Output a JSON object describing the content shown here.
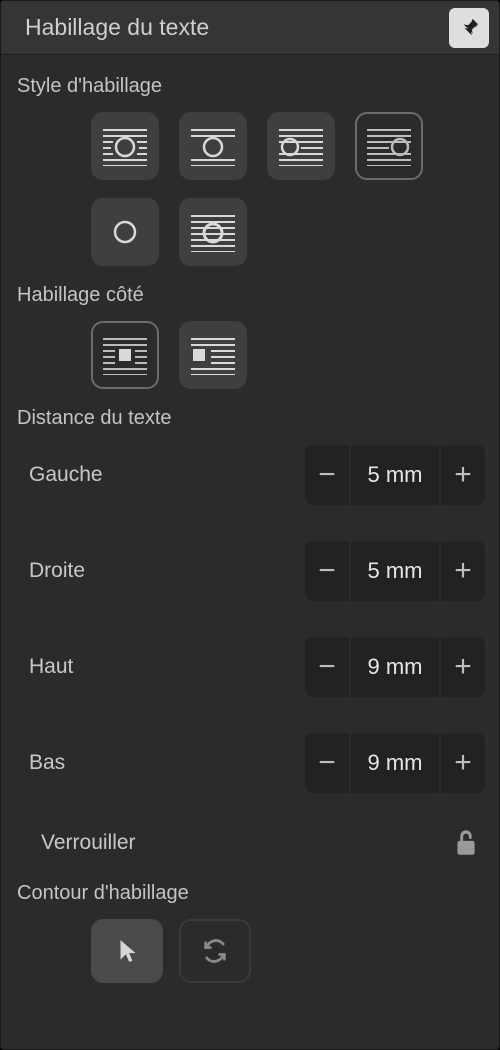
{
  "title": "Habillage du texte",
  "sections": {
    "style": "Style d'habillage",
    "side": "Habillage côté",
    "distance": "Distance du texte",
    "lock": "Verrouiller",
    "outline": "Contour d'habillage"
  },
  "style_tiles": [
    {
      "name": "wrap-around-circle",
      "selected": false
    },
    {
      "name": "wrap-jump-circle",
      "selected": false
    },
    {
      "name": "wrap-left-circle",
      "selected": false
    },
    {
      "name": "wrap-right-circle",
      "selected": true
    },
    {
      "name": "wrap-none",
      "selected": false
    },
    {
      "name": "wrap-inside",
      "selected": false
    }
  ],
  "side_tiles": [
    {
      "name": "side-square-center",
      "selected": true
    },
    {
      "name": "side-square-left",
      "selected": false
    }
  ],
  "distances": {
    "left": {
      "label": "Gauche",
      "value": "5 mm"
    },
    "right": {
      "label": "Droite",
      "value": "5 mm"
    },
    "top": {
      "label": "Haut",
      "value": "9 mm"
    },
    "bottom": {
      "label": "Bas",
      "value": "9 mm"
    }
  }
}
